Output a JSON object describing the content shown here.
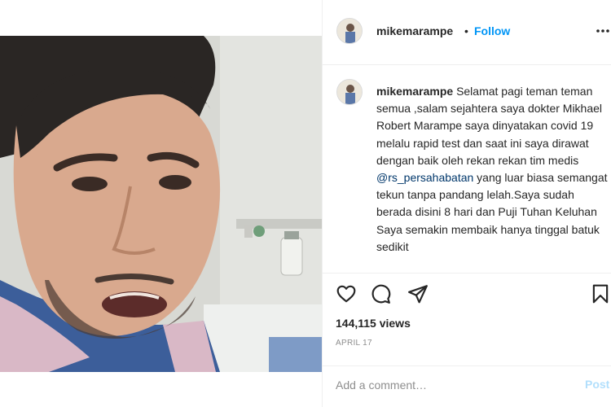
{
  "post": {
    "author": "mikemarampe",
    "separator": "•",
    "follow_label": "Follow",
    "caption_before_mention": "Selamat pagi teman teman semua ,salam sejahtera saya dokter Mikhael Robert Marampe saya dinyatakan covid 19 melalu rapid test dan saat ini saya dirawat dengan baik oleh rekan rekan tim medis ",
    "mention": "@rs_persahabatan",
    "caption_after_mention": " yang luar biasa semangat tekun tanpa pandang lelah.Saya sudah berada disini 8 hari dan Puji Tuhan Keluhan Saya semakin membaik hanya tinggal batuk sedikit",
    "views": "144,115 views",
    "date": "APRIL 17"
  },
  "comment": {
    "placeholder": "Add a comment…",
    "post_label": "Post"
  },
  "icons": {
    "more": "more-options-icon",
    "like": "heart-icon",
    "comment": "comment-bubble-icon",
    "share": "paper-plane-icon",
    "save": "bookmark-icon"
  },
  "colors": {
    "accent": "#0095f6",
    "mention": "#00376b",
    "post_disabled": "#b2dffc",
    "muted": "#8e8e8e"
  }
}
